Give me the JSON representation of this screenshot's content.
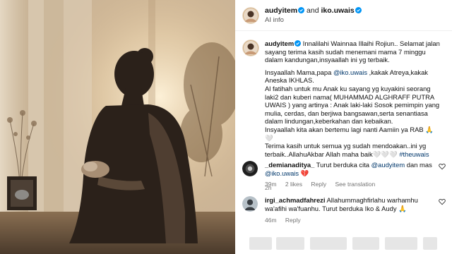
{
  "post": {
    "header": {
      "author": "audyitem",
      "and_text": "and",
      "coauthor": "iko.uwais",
      "subtitle": "AI info"
    },
    "caption": {
      "username": "audyitem",
      "lines": [
        "Innalilahi Wainnaa Illaihi Rojiun.. Selamat jalan sayang terima kasih sudah menemani mama 7 minggu dalam kandungan,insyaallah ini yg terbaik.",
        "Insyaallah Mama,papa",
        "@iko.uwais",
        ",kakak Atreya,kakak Aneska IKHLAS.",
        "Al fatihah untuk mu Anak ku sayang yg kuyakini seorang laki2 dan kuberi nama( MUHAMMAD ALGHRAFF PUTRA UWAIS ) yang artinya : Anak laki-laki Sosok pemimpin yang mulia, cerdas, dan berjiwa bangsawan,serta senantiasa dalam lindungan,keberkahan dan kebaikan.",
        "Insyaallah kita akan bertemu lagi nanti Aamiin ya RAB 🙏 🤍",
        "Terima kasih untuk semua yg sudah mendoakan..ini yg terbaik..AllahuAkbar Allah maha baik🤍🤍🤍",
        "#theuwais"
      ],
      "time": "2h"
    },
    "comments": [
      {
        "username": "_demianaditya_",
        "text_before": "Turut berduka cita",
        "mention1": "@audyitem",
        "text_mid": "dan mas",
        "mention2": "@iko.uwais",
        "emoji": "💔",
        "time": "39m",
        "likes": "2 likes",
        "reply": "Reply",
        "translation": "See translation"
      },
      {
        "username": "irgi_achmadfahrezi",
        "text": "Allahummaghfirlahu warhamhu wa'afihi wa'fuanhu. Turut berduka Iko & Audy 🙏",
        "time": "46m",
        "reply": "Reply"
      }
    ]
  },
  "icons": {
    "verified": "verified-badge-icon",
    "more": "more-options-icon",
    "heart": "heart-outline-icon"
  },
  "colors": {
    "verified": "#0095f6",
    "mention": "#00376b",
    "muted": "#737373"
  }
}
